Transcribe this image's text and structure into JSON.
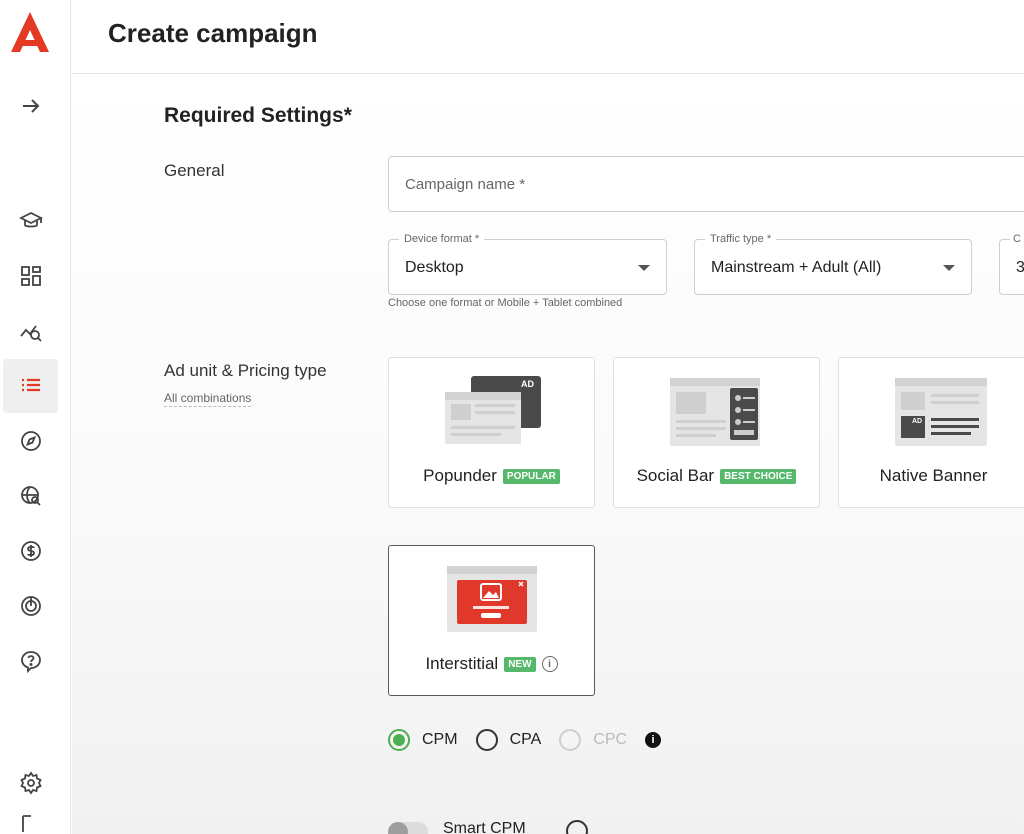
{
  "header": {
    "title": "Create campaign"
  },
  "sidebar": {
    "items": [
      {
        "name": "expand-arrow-icon"
      },
      {
        "name": "graduation-cap-icon"
      },
      {
        "name": "dashboard-icon"
      },
      {
        "name": "analytics-icon"
      },
      {
        "name": "campaigns-list-icon",
        "active": true
      },
      {
        "name": "compass-icon"
      },
      {
        "name": "globe-search-icon"
      },
      {
        "name": "dollar-icon"
      },
      {
        "name": "target-icon"
      },
      {
        "name": "help-icon"
      },
      {
        "name": "settings-gear-icon"
      }
    ]
  },
  "main": {
    "section_title": "Required Settings*",
    "general_label": "General",
    "campaign_name": {
      "placeholder": "Campaign name *",
      "value": ""
    },
    "device_format": {
      "label": "Device format *",
      "value": "Desktop",
      "helper": "Choose one format or Mobile + Tablet combined"
    },
    "traffic_type": {
      "label": "Traffic type *",
      "value": "Mainstream + Adult (All)"
    },
    "third_select": {
      "label": "C",
      "value": "3"
    },
    "ad_unit": {
      "label": "Ad unit & Pricing type",
      "sub_link": "All combinations",
      "cards": [
        {
          "title": "Popunder",
          "badge": "POPULAR",
          "selected": false
        },
        {
          "title": "Social Bar",
          "badge": "BEST CHOICE",
          "selected": false
        },
        {
          "title": "Native Banner",
          "badge": "",
          "selected": false
        },
        {
          "title": "Interstitial",
          "badge": "NEW",
          "selected": true
        }
      ],
      "illustration_badge": "AD"
    },
    "pricing": {
      "options": [
        {
          "label": "CPM",
          "checked": true,
          "disabled": false
        },
        {
          "label": "CPA",
          "checked": false,
          "disabled": false
        },
        {
          "label": "CPC",
          "checked": false,
          "disabled": true
        }
      ],
      "info_glyph": "i"
    },
    "smart_cpm": {
      "label": "Smart CPM"
    }
  },
  "colors": {
    "accent": "#e43a23",
    "badge_green": "#55b86a",
    "radio_green": "#4caf50"
  }
}
